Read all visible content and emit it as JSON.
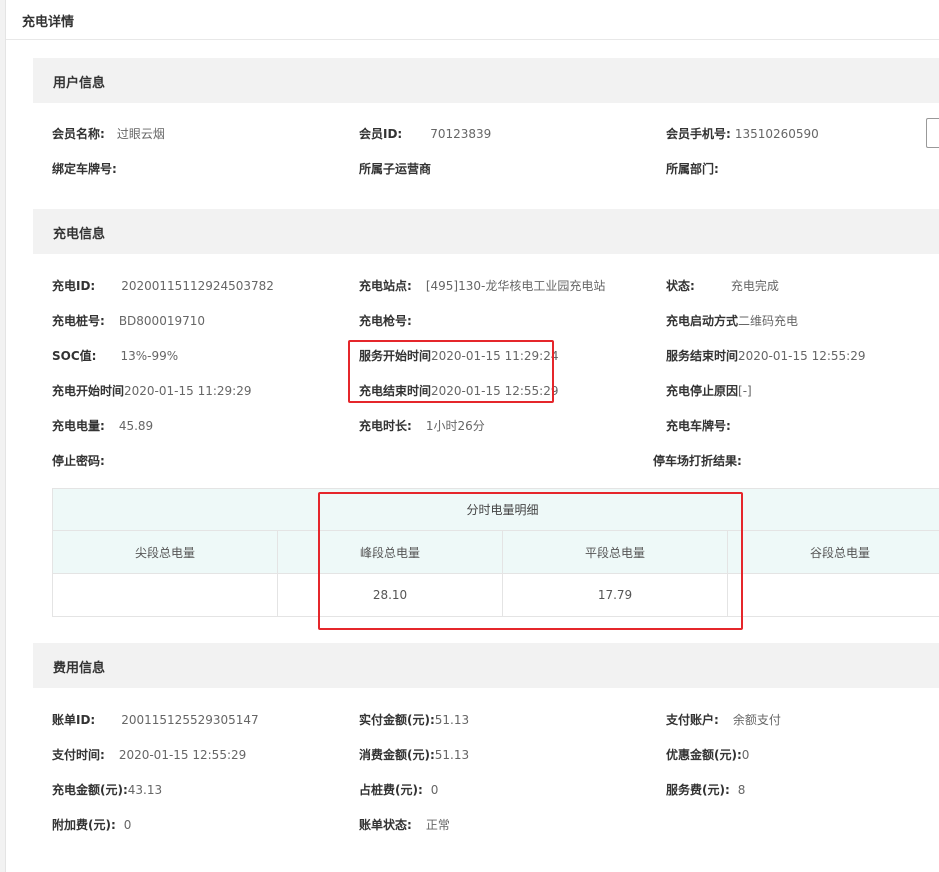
{
  "window": {
    "title": "充电详情"
  },
  "sections": {
    "user": "用户信息",
    "charge": "充电信息",
    "fee": "费用信息"
  },
  "user": {
    "member_name": {
      "label": "会员名称:",
      "value": "过眼云烟"
    },
    "member_id": {
      "label": "会员ID:",
      "value": "70123839"
    },
    "member_phone": {
      "label": "会员手机号:",
      "value": "13510260590"
    },
    "bound_plate": {
      "label": "绑定车牌号:",
      "value": ""
    },
    "sub_operator": {
      "label": "所属子运营商",
      "value": ""
    },
    "department": {
      "label": "所属部门:",
      "value": ""
    }
  },
  "charge": {
    "charge_id": {
      "label": "充电ID:",
      "value": "20200115112924503782"
    },
    "station": {
      "label": "充电站点:",
      "value": "[495]130-龙华核电工业园充电站"
    },
    "status": {
      "label": "状态:",
      "value": "充电完成"
    },
    "pile_no": {
      "label": "充电桩号:",
      "value": "BD800019710"
    },
    "gun_no": {
      "label": "充电枪号:",
      "value": ""
    },
    "start_method": {
      "label": "充电启动方式",
      "value": "二维码充电"
    },
    "soc": {
      "label": "SOC值:",
      "value": "13%-99%"
    },
    "service_start": {
      "label": "服务开始时间",
      "value": "2020-01-15 11:29:24"
    },
    "service_end": {
      "label": "服务结束时间",
      "value": "2020-01-15 12:55:29"
    },
    "charge_start": {
      "label": "充电开始时间",
      "value": "2020-01-15 11:29:29"
    },
    "charge_end": {
      "label": "充电结束时间",
      "value": "2020-01-15 12:55:29"
    },
    "stop_reason": {
      "label": "充电停止原因",
      "value": "[-]"
    },
    "energy": {
      "label": "充电电量:",
      "value": "45.89"
    },
    "duration": {
      "label": "充电时长:",
      "value": "1小时26分"
    },
    "charge_plate": {
      "label": "充电车牌号:",
      "value": ""
    },
    "stop_password": {
      "label": "停止密码:",
      "value": ""
    },
    "parking_discount": {
      "label": "停车场打折结果:",
      "value": ""
    }
  },
  "detail_table": {
    "caption": "分时电量明细",
    "headers": [
      "尖段总电量",
      "峰段总电量",
      "平段总电量",
      "谷段总电量"
    ],
    "values": [
      "",
      "28.10",
      "17.79",
      ""
    ]
  },
  "fee": {
    "bill_id": {
      "label": "账单ID:",
      "value": "200115125529305147"
    },
    "paid_amount": {
      "label": "实付金额(元):",
      "value": "51.13"
    },
    "pay_account": {
      "label": "支付账户:",
      "value": "余额支付"
    },
    "pay_time": {
      "label": "支付时间:",
      "value": "2020-01-15 12:55:29"
    },
    "consume_amount": {
      "label": "消费金额(元):",
      "value": "51.13"
    },
    "discount_amount": {
      "label": "优惠金额(元):",
      "value": "0"
    },
    "charge_amount": {
      "label": "充电金额(元):",
      "value": "43.13"
    },
    "occupy_fee": {
      "label": "占桩费(元):",
      "value": "0"
    },
    "service_fee": {
      "label": "服务费(元):",
      "value": "8"
    },
    "extra_fee": {
      "label": "附加费(元):",
      "value": "0"
    },
    "bill_status": {
      "label": "账单状态:",
      "value": "正常"
    }
  },
  "colors": {
    "highlight": "#e5262b",
    "table_header_bg": "#eef9f8",
    "section_bg": "#f2f2f2"
  }
}
